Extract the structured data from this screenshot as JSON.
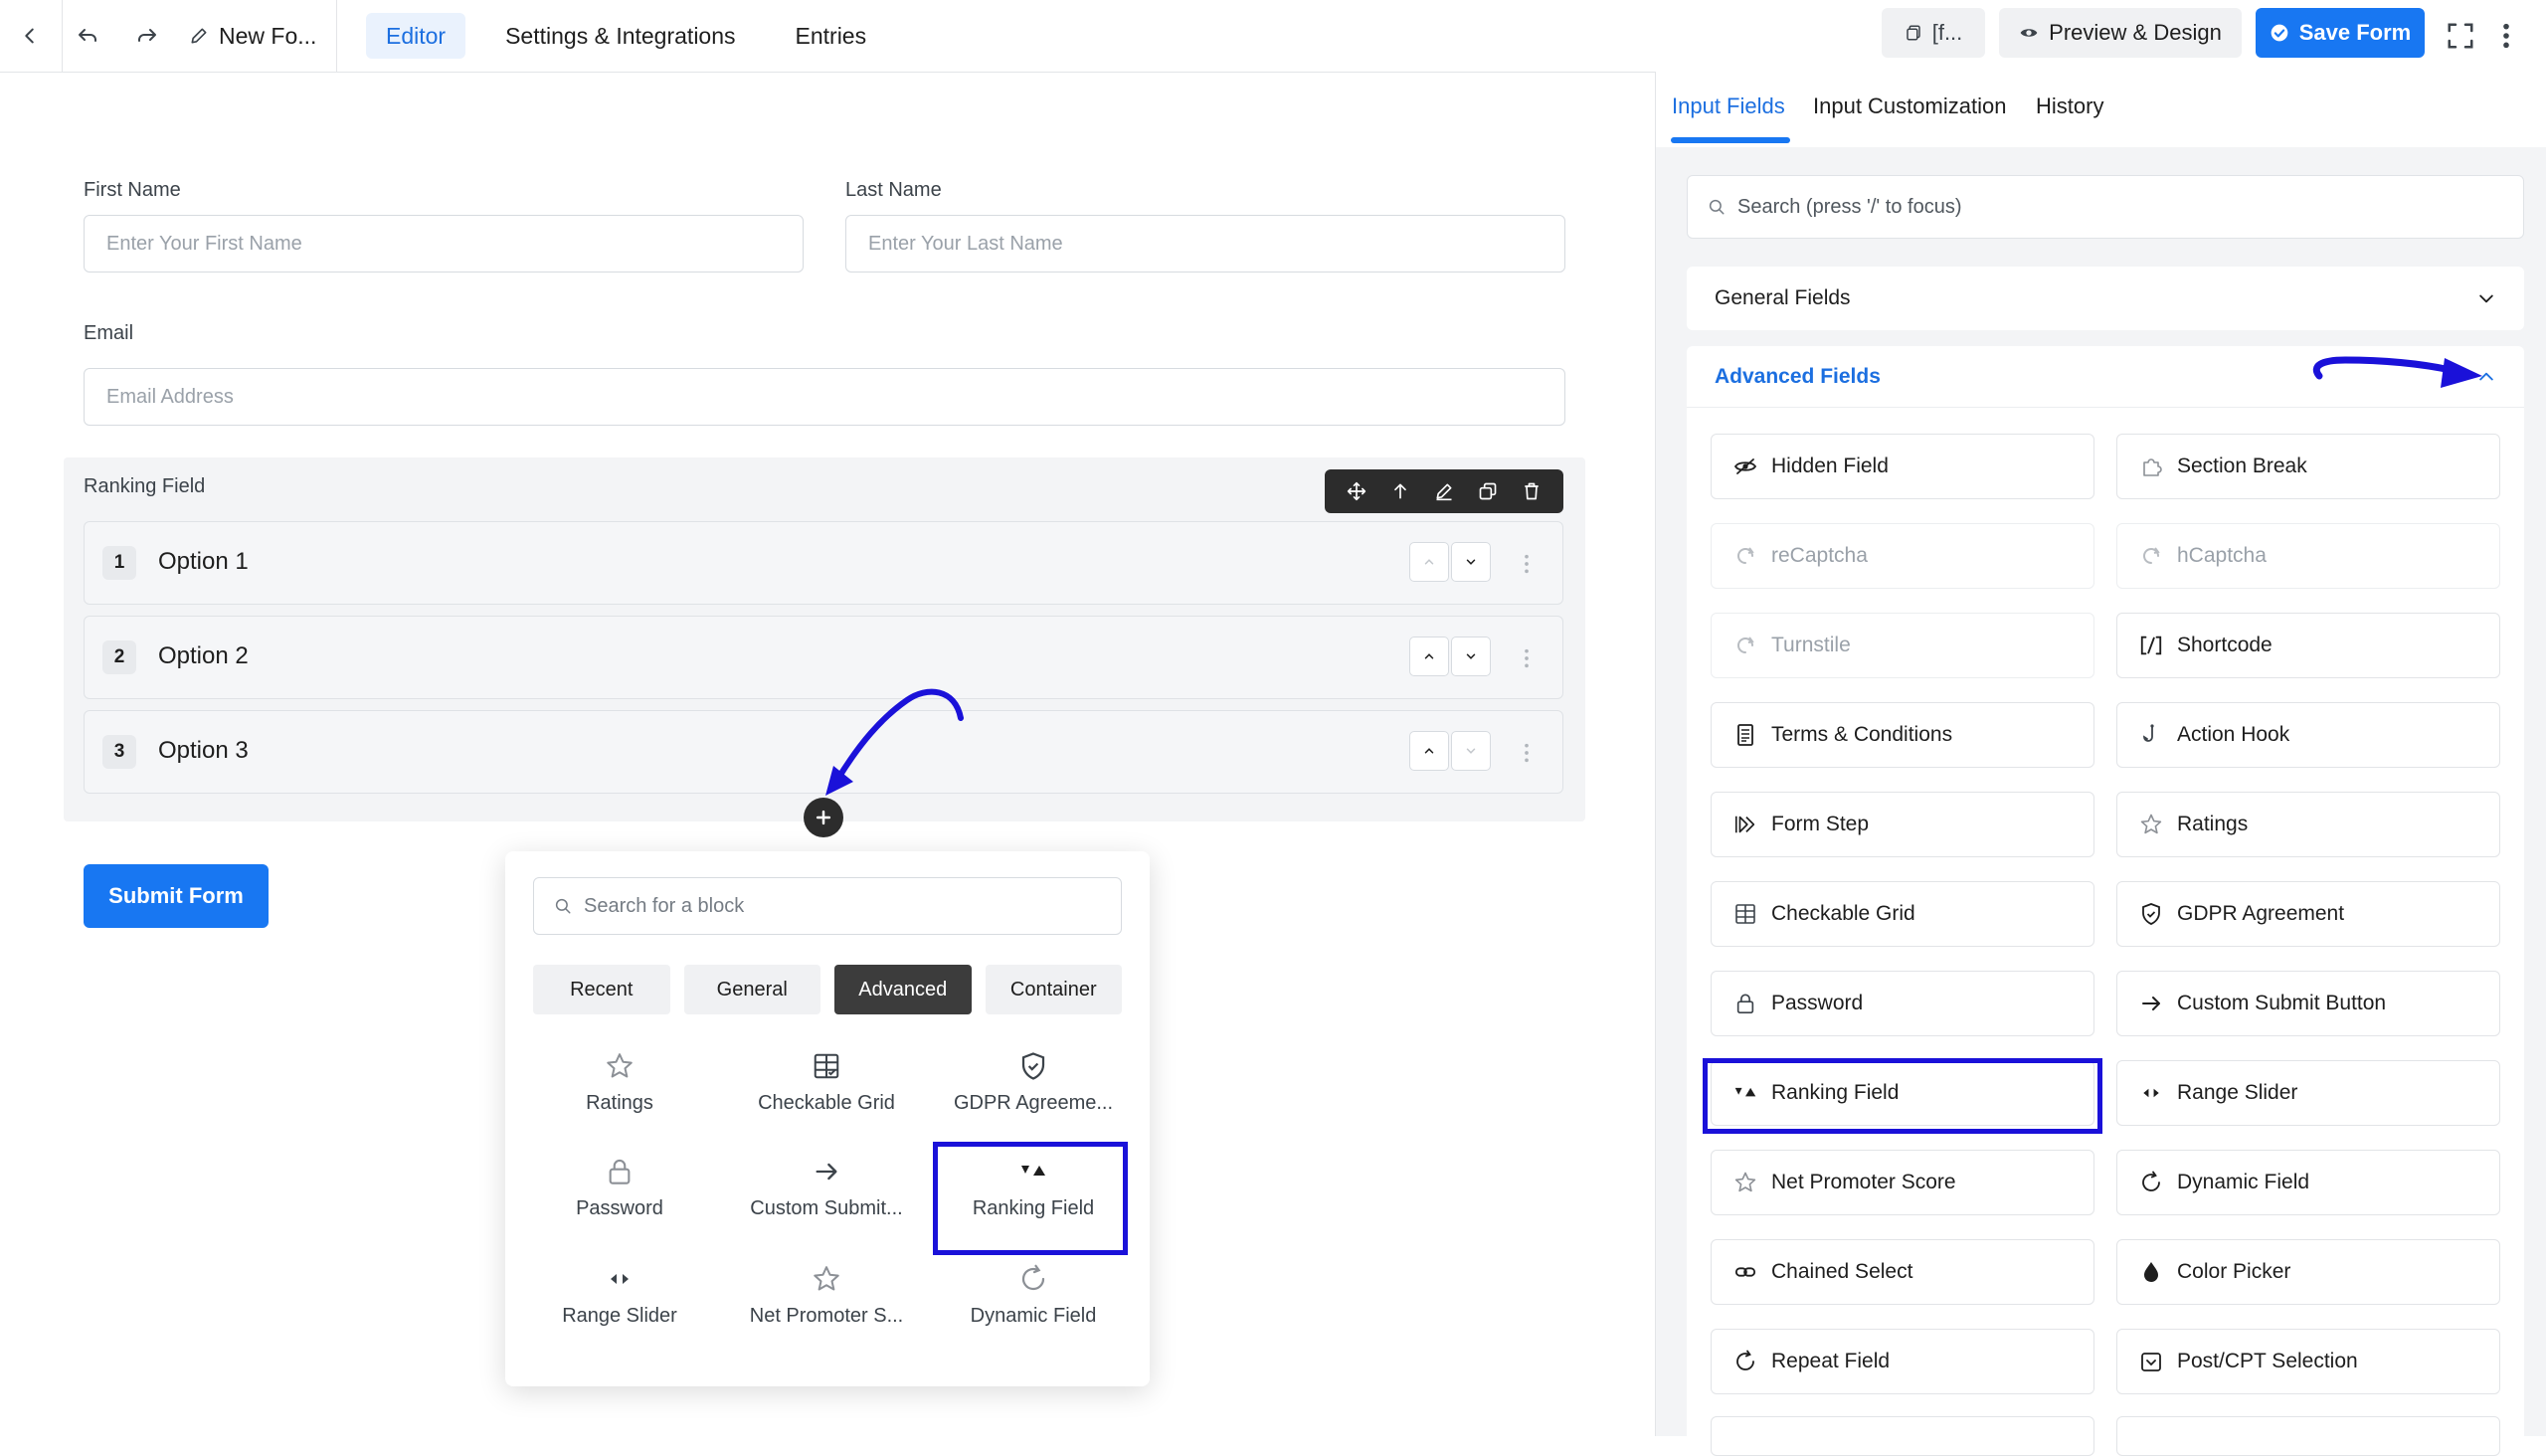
{
  "topbar": {
    "form_name": "New Fo...",
    "tabs": [
      "Editor",
      "Settings & Integrations",
      "Entries"
    ],
    "shortcode_label": "[f...",
    "preview_label": "Preview & Design",
    "save_label": "Save Form"
  },
  "editor": {
    "first_name_label": "First Name",
    "first_name_placeholder": "Enter Your First Name",
    "last_name_label": "Last Name",
    "last_name_placeholder": "Enter Your Last Name",
    "email_label": "Email",
    "email_placeholder": "Email Address",
    "ranking_label": "Ranking Field",
    "options": [
      {
        "num": "1",
        "text": "Option 1"
      },
      {
        "num": "2",
        "text": "Option 2"
      },
      {
        "num": "3",
        "text": "Option 3"
      }
    ],
    "submit_label": "Submit Form"
  },
  "popover": {
    "search_placeholder": "Search for a block",
    "tabs": [
      "Recent",
      "General",
      "Advanced",
      "Container"
    ],
    "active_tab": "Advanced",
    "items": [
      {
        "label": "Ratings",
        "icon": "star-icon"
      },
      {
        "label": "Checkable Grid",
        "icon": "grid-icon"
      },
      {
        "label": "GDPR Agreeme...",
        "icon": "shield-icon"
      },
      {
        "label": "Password",
        "icon": "lock-icon"
      },
      {
        "label": "Custom Submit...",
        "icon": "arrow-right-icon"
      },
      {
        "label": "Ranking Field",
        "icon": "ranking-icon"
      },
      {
        "label": "Range Slider",
        "icon": "range-icon"
      },
      {
        "label": "Net Promoter S...",
        "icon": "star-icon"
      },
      {
        "label": "Dynamic Field",
        "icon": "refresh-icon"
      }
    ]
  },
  "panel": {
    "tabs": [
      "Input Fields",
      "Input Customization",
      "History"
    ],
    "active_tab": "Input Fields",
    "search_placeholder": "Search (press '/' to focus)",
    "general_section": "General Fields",
    "advanced_section": "Advanced Fields",
    "advanced_fields": [
      {
        "label": "Hidden Field",
        "icon": "eye-slash-icon",
        "disabled": false
      },
      {
        "label": "Section Break",
        "icon": "puzzle-icon",
        "disabled": false
      },
      {
        "label": "reCaptcha",
        "icon": "captcha-icon",
        "disabled": true
      },
      {
        "label": "hCaptcha",
        "icon": "captcha-icon",
        "disabled": true
      },
      {
        "label": "Turnstile",
        "icon": "captcha-icon",
        "disabled": true
      },
      {
        "label": "Shortcode",
        "icon": "shortcode-icon",
        "disabled": false
      },
      {
        "label": "Terms & Conditions",
        "icon": "document-icon",
        "disabled": false
      },
      {
        "label": "Action Hook",
        "icon": "hook-icon",
        "disabled": false
      },
      {
        "label": "Form Step",
        "icon": "step-icon",
        "disabled": false
      },
      {
        "label": "Ratings",
        "icon": "star-icon",
        "disabled": false
      },
      {
        "label": "Checkable Grid",
        "icon": "grid-icon",
        "disabled": false
      },
      {
        "label": "GDPR Agreement",
        "icon": "shield-icon",
        "disabled": false
      },
      {
        "label": "Password",
        "icon": "lock-icon",
        "disabled": false
      },
      {
        "label": "Custom Submit Button",
        "icon": "arrow-right-icon",
        "disabled": false
      },
      {
        "label": "Ranking Field",
        "icon": "ranking-icon",
        "disabled": false
      },
      {
        "label": "Range Slider",
        "icon": "range-icon",
        "disabled": false
      },
      {
        "label": "Net Promoter Score",
        "icon": "star-icon",
        "disabled": false
      },
      {
        "label": "Dynamic Field",
        "icon": "refresh-icon",
        "disabled": false
      },
      {
        "label": "Chained Select",
        "icon": "link-icon",
        "disabled": false
      },
      {
        "label": "Color Picker",
        "icon": "drop-icon",
        "disabled": false
      },
      {
        "label": "Repeat Field",
        "icon": "refresh-icon",
        "disabled": false
      },
      {
        "label": "Post/CPT Selection",
        "icon": "post-icon",
        "disabled": false
      }
    ]
  },
  "colors": {
    "primary": "#1877f2",
    "annotation": "#1a11d9",
    "dark_toolbar": "#2c2c2c"
  }
}
